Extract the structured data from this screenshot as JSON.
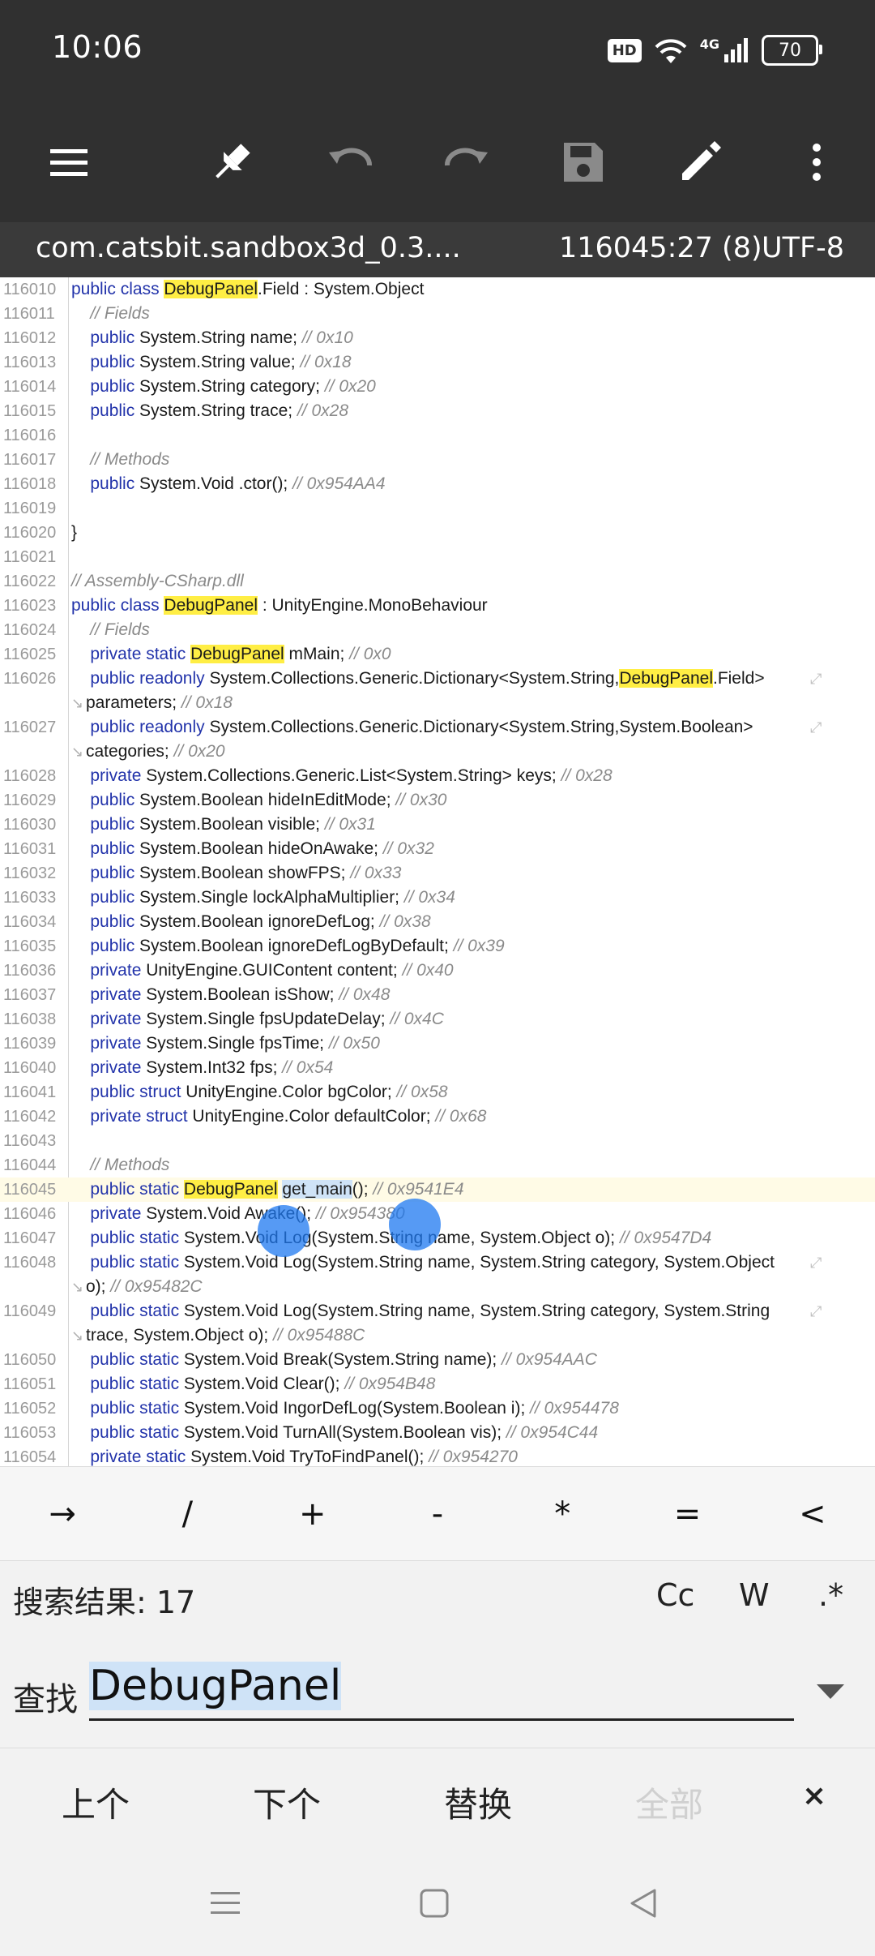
{
  "status_bar": {
    "time": "10:06",
    "icons": [
      "hd-icon",
      "wifi-icon",
      "signal-4g-icon",
      "battery-icon"
    ],
    "hd_label": "HD",
    "net_label": "4G",
    "battery_level": "70"
  },
  "toolbar": {
    "buttons": [
      "menu-icon",
      "pin-icon",
      "undo-icon",
      "redo-icon",
      "save-icon",
      "edit-icon",
      "more-vert-icon"
    ]
  },
  "info_bar": {
    "file_name": "com.catsbit.sandbox3d_0.3....",
    "cursor_position": "116045:27 (8)",
    "encoding": "UTF-8"
  },
  "editor": {
    "lines": [
      {
        "n": "116010",
        "t": "{kw:public} {kw:class} {hl:DebugPanel}.Field : System.Object"
      },
      {
        "n": "116011",
        "t": "    {cm:// Fields}"
      },
      {
        "n": "116012",
        "t": "    {kw:public} System.String name; {cm:// 0x10}"
      },
      {
        "n": "116013",
        "t": "    {kw:public} System.String value; {cm:// 0x18}"
      },
      {
        "n": "116014",
        "t": "    {kw:public} System.String category; {cm:// 0x20}"
      },
      {
        "n": "116015",
        "t": "    {kw:public} System.String trace; {cm:// 0x28}"
      },
      {
        "n": "116016",
        "t": ""
      },
      {
        "n": "116017",
        "t": "    {cm:// Methods}"
      },
      {
        "n": "116018",
        "t": "    {kw:public} System.Void .ctor(); {cm:// 0x954AA4}"
      },
      {
        "n": "116019",
        "t": ""
      },
      {
        "n": "116020",
        "t": "}"
      },
      {
        "n": "116021",
        "t": ""
      },
      {
        "n": "116022",
        "t": "{cm:// Assembly-CSharp.dll}"
      },
      {
        "n": "116023",
        "t": "{kw:public} {kw:class} {hl:DebugPanel} : UnityEngine.MonoBehaviour"
      },
      {
        "n": "116024",
        "t": "    {cm:// Fields}"
      },
      {
        "n": "116025",
        "t": "    {kw:private} {kw:static} {hl:DebugPanel} mMain; {cm:// 0x0}"
      },
      {
        "n": "116026",
        "t": "    {kw:public} {kw:readonly} System.Collections.Generic.Dictionary<System.String,{hl:DebugPanel}.Field>",
        "wrap": true
      },
      {
        "n": "",
        "t": "parameters; {cm:// 0x18}",
        "cont": true
      },
      {
        "n": "116027",
        "t": "    {kw:public} {kw:readonly} System.Collections.Generic.Dictionary<System.String,System.Boolean>",
        "wrap": true
      },
      {
        "n": "",
        "t": "categories; {cm:// 0x20}",
        "cont": true
      },
      {
        "n": "116028",
        "t": "    {kw:private} System.Collections.Generic.List<System.String> keys; {cm:// 0x28}"
      },
      {
        "n": "116029",
        "t": "    {kw:public} System.Boolean hideInEditMode; {cm:// 0x30}"
      },
      {
        "n": "116030",
        "t": "    {kw:public} System.Boolean visible; {cm:// 0x31}"
      },
      {
        "n": "116031",
        "t": "    {kw:public} System.Boolean hideOnAwake; {cm:// 0x32}"
      },
      {
        "n": "116032",
        "t": "    {kw:public} System.Boolean showFPS; {cm:// 0x33}"
      },
      {
        "n": "116033",
        "t": "    {kw:public} System.Single lockAlphaMultiplier; {cm:// 0x34}"
      },
      {
        "n": "116034",
        "t": "    {kw:public} System.Boolean ignoreDefLog; {cm:// 0x38}"
      },
      {
        "n": "116035",
        "t": "    {kw:public} System.Boolean ignoreDefLogByDefault; {cm:// 0x39}"
      },
      {
        "n": "116036",
        "t": "    {kw:private} UnityEngine.GUIContent content; {cm:// 0x40}"
      },
      {
        "n": "116037",
        "t": "    {kw:private} System.Boolean isShow; {cm:// 0x48}"
      },
      {
        "n": "116038",
        "t": "    {kw:private} System.Single fpsUpdateDelay; {cm:// 0x4C}"
      },
      {
        "n": "116039",
        "t": "    {kw:private} System.Single fpsTime; {cm:// 0x50}"
      },
      {
        "n": "116040",
        "t": "    {kw:private} System.Int32 fps; {cm:// 0x54}"
      },
      {
        "n": "116041",
        "t": "    {kw:public} {kw:struct} UnityEngine.Color bgColor; {cm:// 0x58}"
      },
      {
        "n": "116042",
        "t": "    {kw:private} {kw:struct} UnityEngine.Color defaultColor; {cm:// 0x68}"
      },
      {
        "n": "116043",
        "t": ""
      },
      {
        "n": "116044",
        "t": "    {cm:// Methods}"
      },
      {
        "n": "116045",
        "t": "    {kw:public} {kw:static} {hl:DebugPanel} {sel:get_main}(); {cm:// 0x9541E4}",
        "current": true
      },
      {
        "n": "116046",
        "t": "    {kw:private} System.Void Awake(); {cm:// 0x954380}"
      },
      {
        "n": "116047",
        "t": "    {kw:public} {kw:static} System.Void Log(System.String name, System.Object o); {cm:// 0x9547D4}"
      },
      {
        "n": "116048",
        "t": "    {kw:public} {kw:static} System.Void Log(System.String name, System.String category, System.Object",
        "wrap": true
      },
      {
        "n": "",
        "t": "o); {cm:// 0x95482C}",
        "cont": true
      },
      {
        "n": "116049",
        "t": "    {kw:public} {kw:static} System.Void Log(System.String name, System.String category, System.String",
        "wrap": true
      },
      {
        "n": "",
        "t": "trace, System.Object o); {cm:// 0x95488C}",
        "cont": true
      },
      {
        "n": "116050",
        "t": "    {kw:public} {kw:static} System.Void Break(System.String name); {cm:// 0x954AAC}"
      },
      {
        "n": "116051",
        "t": "    {kw:public} {kw:static} System.Void Clear(); {cm:// 0x954B48}"
      },
      {
        "n": "116052",
        "t": "    {kw:public} {kw:static} System.Void IngorDefLog(System.Boolean i); {cm:// 0x954478}"
      },
      {
        "n": "116053",
        "t": "    {kw:public} {kw:static} System.Void TurnAll(System.Boolean vis); {cm:// 0x954C44}"
      },
      {
        "n": "116054",
        "t": "    {kw:private} {kw:static} System.Void TryToFindPanel(); {cm:// 0x954270}"
      }
    ]
  },
  "symbol_bar": {
    "keys": [
      "→",
      "/",
      "+",
      "-",
      "*",
      "=",
      "<"
    ]
  },
  "search": {
    "results_label": "搜索结果: 17",
    "options": [
      "Cc",
      "W",
      ".*"
    ],
    "find_label": "查找",
    "find_value": "DebugPanel"
  },
  "actions": {
    "prev": "上个",
    "next": "下个",
    "replace": "替换",
    "all": "全部",
    "close": "×"
  },
  "nav_bar": {
    "buttons": [
      "recents-icon",
      "home-icon",
      "back-icon"
    ]
  },
  "colors": {
    "toolbar_bg": "#303030",
    "keyword": "#2233aa",
    "comment": "#8a8a8a",
    "match_highlight": "#ffee44",
    "selection": "#cfe3f7"
  }
}
